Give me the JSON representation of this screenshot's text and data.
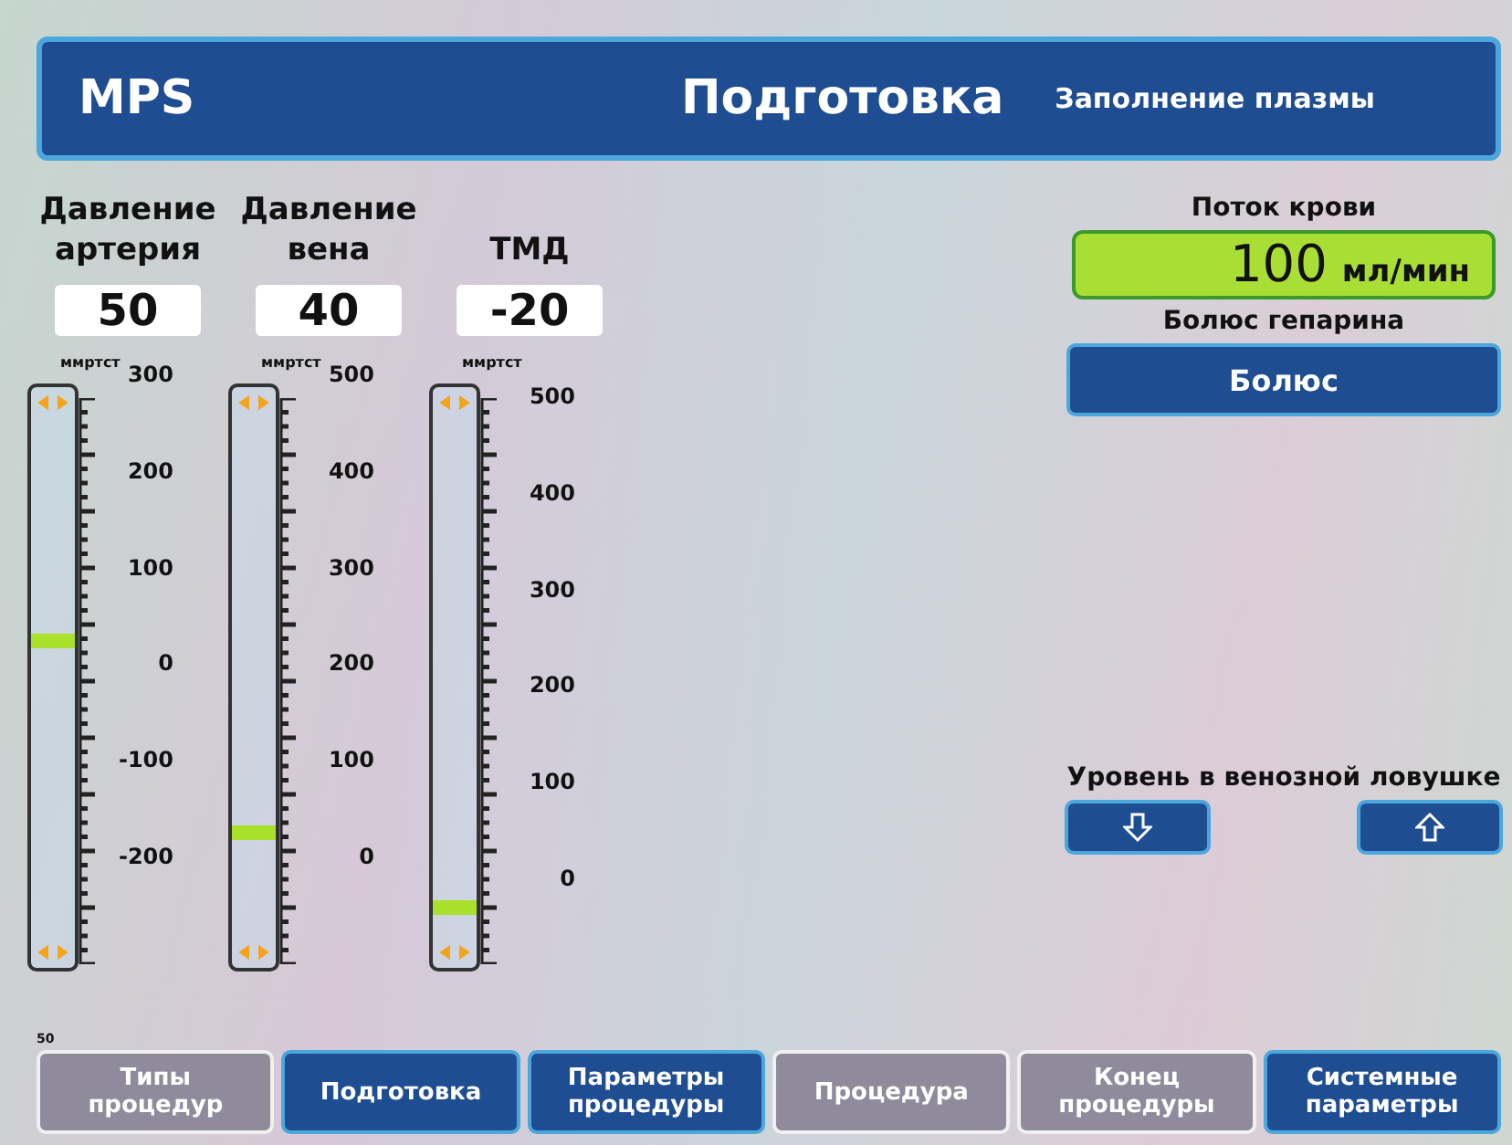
{
  "header": {
    "brand": "MPS",
    "title": "Подготовка",
    "subtitle": "Заполнение плазмы"
  },
  "gauges": [
    {
      "label": "Давление артерия",
      "value": "50",
      "unit": "ммртст",
      "ticks": [
        "300",
        "200",
        "100",
        "0",
        "-100",
        "-200"
      ],
      "level": 0.55
    },
    {
      "label": "Давление вена",
      "value": "40",
      "unit": "ммртст",
      "ticks": [
        "500",
        "400",
        "300",
        "200",
        "100",
        "0"
      ],
      "level": 0.22
    },
    {
      "label": "ТМД",
      "value": "-20",
      "unit": "ммртст",
      "ticks": [
        "500",
        "400",
        "300",
        "200",
        "100",
        "0"
      ],
      "level": 0.09
    }
  ],
  "blood_flow": {
    "label": "Поток крови",
    "value": "100",
    "unit": "мл/мин"
  },
  "heparin": {
    "label": "Болюс гепарина",
    "button": "Болюс"
  },
  "chamber_level": {
    "label": "Уровень в венозной ловушке"
  },
  "corner_text": "50",
  "nav": [
    {
      "label": "Типы процедур",
      "disabled": true
    },
    {
      "label": "Подготовка",
      "disabled": false
    },
    {
      "label": "Параметры процедуры",
      "disabled": false
    },
    {
      "label": "Процедура",
      "disabled": true
    },
    {
      "label": "Конец процедуры",
      "disabled": true
    },
    {
      "label": "Системные параметры",
      "disabled": false
    }
  ]
}
